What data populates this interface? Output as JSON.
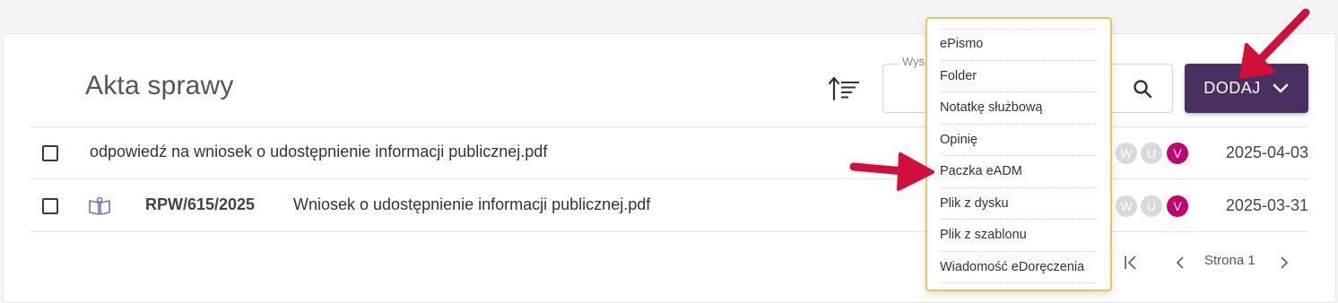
{
  "header": {
    "title": "Akta sprawy",
    "search_legend": "Wys",
    "add_button_label": "DODAJ"
  },
  "rows": [
    {
      "file_name": "odpowiedź na wniosek o udostępnienie informacji publicznej.pdf",
      "signature": "",
      "badges": [
        "W",
        "U",
        "V"
      ],
      "date": "2025-04-03"
    },
    {
      "file_name": "Wniosek o udostępnienie informacji publicznej.pdf",
      "signature": "RPW/615/2025",
      "badges": [
        "W",
        "U",
        "V"
      ],
      "date": "2025-03-31"
    }
  ],
  "pagination": {
    "page_label": "Strona 1"
  },
  "add_menu": {
    "items": [
      "ePismo",
      "Folder",
      "Notatkę służbową",
      "Opinię",
      "Paczka eADM",
      "Plik z dysku",
      "Plik z szablonu",
      "Wiadomość eDoręczenia"
    ]
  },
  "colors": {
    "primary": "#4a3060",
    "badge_active": "#c4006e",
    "badge_inactive": "#d9d9dc",
    "menu_border": "#f0c35a",
    "annotation_arrow": "#d0103a"
  },
  "icons": {
    "sort": "sort-icon",
    "search": "search-icon",
    "chevron": "chevron-down-icon",
    "book": "book-icon"
  }
}
